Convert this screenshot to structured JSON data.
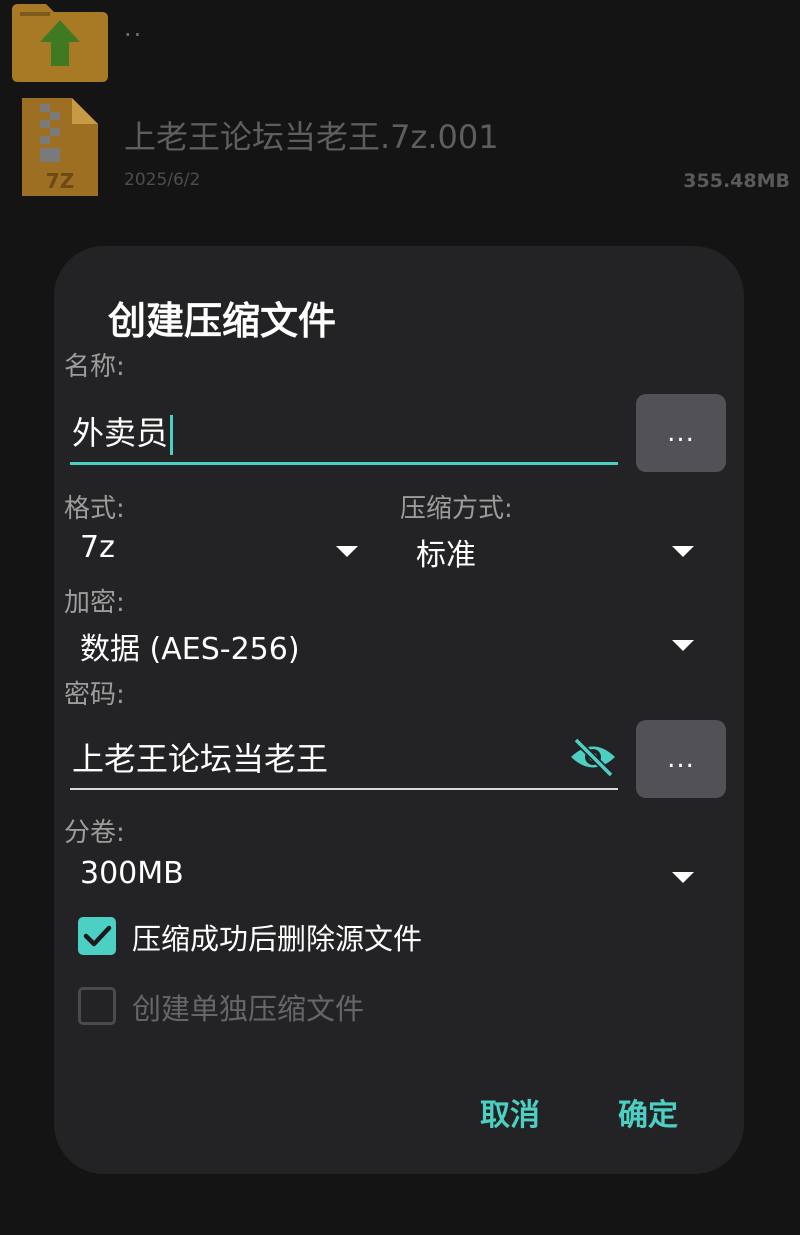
{
  "file_list": {
    "parent_label": "..",
    "archive": {
      "name": "上老王论坛当老王.7z.001",
      "date": "2025/6/2",
      "size": "355.48MB",
      "icon_badge": "7Z"
    }
  },
  "dialog": {
    "title": "创建压缩文件",
    "name_label": "名称:",
    "name_value": "外卖员",
    "browse_label": "...",
    "format_label": "格式:",
    "format_value": "7z",
    "method_label": "压缩方式:",
    "method_value": "标准",
    "encryption_label": "加密:",
    "encryption_value": "数据 (AES-256)",
    "password_label": "密码:",
    "password_value": "上老王论坛当老王",
    "password_more_label": "...",
    "split_label": "分卷:",
    "split_value": "300MB",
    "delete_source": {
      "label": "压缩成功后删除源文件",
      "checked": true
    },
    "separate_archives": {
      "label": "创建单独压缩文件",
      "checked": false,
      "enabled": false
    },
    "cancel_label": "取消",
    "ok_label": "确定"
  },
  "colors": {
    "accent": "#4dd0c4",
    "dialog_bg": "#232325",
    "page_bg": "#141414",
    "folder": "#a97a26"
  }
}
